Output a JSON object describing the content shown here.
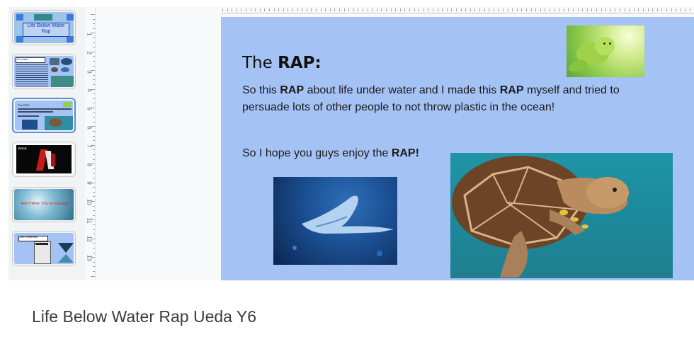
{
  "thumbnails": [
    {
      "label": "Life Below Water Rap"
    },
    {
      "label": "Fun fact!"
    },
    {
      "label": "The RAP:"
    },
    {
      "label": "ROCK"
    },
    {
      "label": "And THANK YOU for listening!"
    },
    {
      "label": "Alex Vermeirsch"
    }
  ],
  "vruler": {
    "numbers": [
      "1",
      "2",
      "3",
      "4",
      "5",
      "6",
      "7",
      "8",
      "9",
      "10",
      "11",
      "12",
      "13"
    ]
  },
  "slide": {
    "title_prefix": "The ",
    "title_bold": "RAP:",
    "para1": {
      "t1": "So this ",
      "b1": "RAP",
      "t2": " about life under water and I made this ",
      "b2": "RAP",
      "t3": " myself and tried to persuade lots of other people to not throw plastic in the ocean!"
    },
    "para2": {
      "t1": "So I hope you guys enjoy the ",
      "b1": "RAP!"
    }
  },
  "document": {
    "title": "Life Below Water Rap Ueda Y6"
  },
  "colors": {
    "slide_bg": "#a4c2f4",
    "selected_thumb_border": "#5b8fd9",
    "thumb1_bg": "#9ec4ea"
  },
  "images": [
    "seal-photo",
    "stingray-photo",
    "sea-turtle-photo"
  ]
}
